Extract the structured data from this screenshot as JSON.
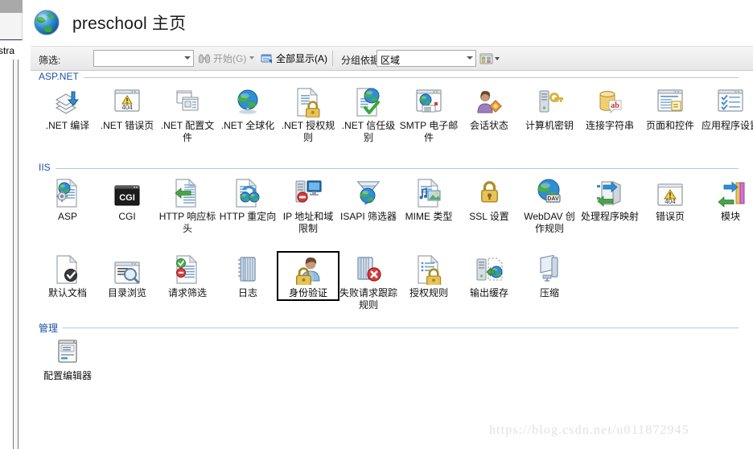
{
  "window": {
    "left_panel_cut_label": "stra"
  },
  "header": {
    "icon": "globe-icon",
    "title": "preschool 主页"
  },
  "toolbar": {
    "filter_label": "筛选:",
    "filter_value": "",
    "filter_placeholder": "",
    "start_label": "开始(G)",
    "start_icon": "binoculars-icon",
    "show_all_label": "全部显示(A)",
    "show_all_icon": "show-all-icon",
    "group_by_label": "分组依据:",
    "group_by_value": "区域",
    "view_icon": "view-mode-icon"
  },
  "groups": [
    {
      "name": "ASP.NET",
      "items": [
        {
          "label": ".NET 编译",
          "icon": "net-compilation-icon",
          "selected": false
        },
        {
          "label": ".NET 错误页",
          "icon": "net-error-pages-icon",
          "selected": false
        },
        {
          "label": ".NET 配置文件",
          "icon": "net-profile-icon",
          "selected": false
        },
        {
          "label": ".NET 全球化",
          "icon": "net-globalization-icon",
          "selected": false
        },
        {
          "label": ".NET 授权规则",
          "icon": "net-authorization-icon",
          "selected": false
        },
        {
          "label": ".NET 信任级别",
          "icon": "net-trust-levels-icon",
          "selected": false
        },
        {
          "label": "SMTP 电子邮件",
          "icon": "smtp-email-icon",
          "selected": false
        },
        {
          "label": "会话状态",
          "icon": "session-state-icon",
          "selected": false
        },
        {
          "label": "计算机密钥",
          "icon": "machine-key-icon",
          "selected": false
        },
        {
          "label": "连接字符串",
          "icon": "connection-strings-icon",
          "selected": false
        },
        {
          "label": "页面和控件",
          "icon": "pages-controls-icon",
          "selected": false
        },
        {
          "label": "应用程序设置",
          "icon": "app-settings-icon",
          "selected": false
        }
      ]
    },
    {
      "name": "IIS",
      "items": [
        {
          "label": "ASP",
          "icon": "asp-icon",
          "selected": false
        },
        {
          "label": "CGI",
          "icon": "cgi-icon",
          "selected": false
        },
        {
          "label": "HTTP 响应标头",
          "icon": "http-response-headers-icon",
          "selected": false
        },
        {
          "label": "HTTP 重定向",
          "icon": "http-redirect-icon",
          "selected": false
        },
        {
          "label": "IP 地址和域限制",
          "icon": "ip-domain-restrictions-icon",
          "selected": false
        },
        {
          "label": "ISAPI 筛选器",
          "icon": "isapi-filters-icon",
          "selected": false
        },
        {
          "label": "MIME 类型",
          "icon": "mime-types-icon",
          "selected": false
        },
        {
          "label": "SSL 设置",
          "icon": "ssl-settings-icon",
          "selected": false
        },
        {
          "label": "WebDAV 创作规则",
          "icon": "webdav-rules-icon",
          "selected": false
        },
        {
          "label": "处理程序映射",
          "icon": "handler-mappings-icon",
          "selected": false
        },
        {
          "label": "错误页",
          "icon": "error-pages-icon",
          "selected": false
        },
        {
          "label": "模块",
          "icon": "modules-icon",
          "selected": false
        },
        {
          "label": "默认文档",
          "icon": "default-document-icon",
          "selected": false
        },
        {
          "label": "目录浏览",
          "icon": "directory-browsing-icon",
          "selected": false
        },
        {
          "label": "请求筛选",
          "icon": "request-filtering-icon",
          "selected": false
        },
        {
          "label": "日志",
          "icon": "logging-icon",
          "selected": false
        },
        {
          "label": "身份验证",
          "icon": "authentication-icon",
          "selected": true
        },
        {
          "label": "失败请求跟踪规则",
          "icon": "failed-request-tracing-icon",
          "selected": false
        },
        {
          "label": "授权规则",
          "icon": "authorization-rules-icon",
          "selected": false
        },
        {
          "label": "输出缓存",
          "icon": "output-caching-icon",
          "selected": false
        },
        {
          "label": "压缩",
          "icon": "compression-icon",
          "selected": false
        }
      ]
    },
    {
      "name": "管理",
      "items": [
        {
          "label": "配置编辑器",
          "icon": "configuration-editor-icon",
          "selected": false
        }
      ]
    }
  ],
  "watermark": {
    "text": "https://blog.csdn.net/u011872945"
  },
  "colors": {
    "group_title": "#1f4fa8",
    "selection_border": "#000000",
    "toolbar_bg": "#eeeeee",
    "watermark": "#e2e2e2"
  }
}
